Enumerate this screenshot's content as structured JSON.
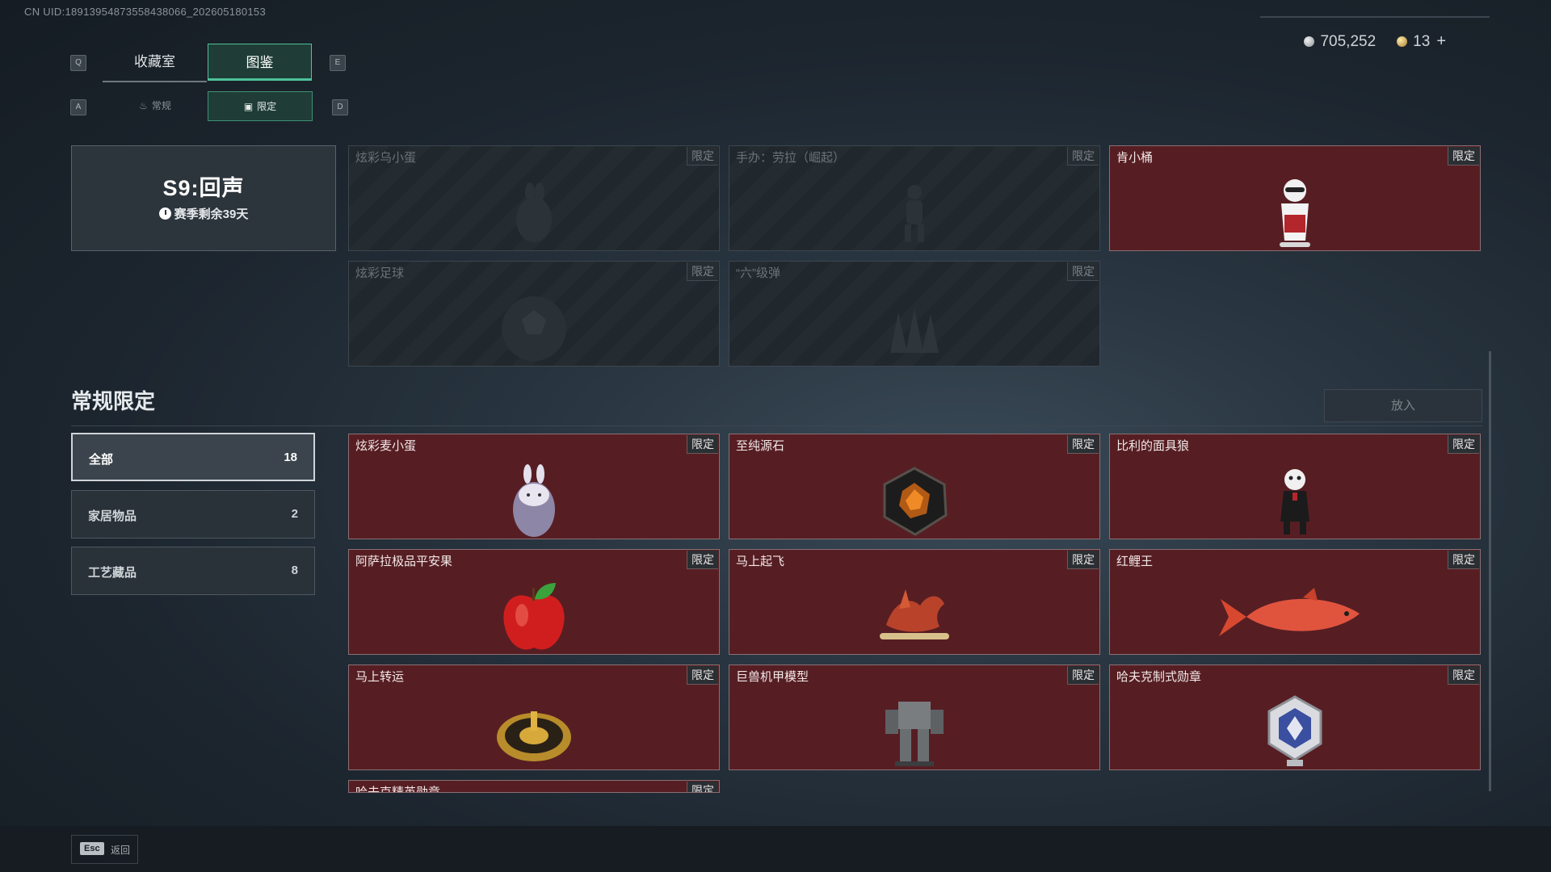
{
  "uid": "CN UID:18913954873558438066_202605180153",
  "keys": {
    "q": "Q",
    "e": "E",
    "a": "A",
    "d": "D",
    "esc": "Esc"
  },
  "tabs_primary": [
    {
      "label": "收藏室"
    },
    {
      "label": "图鉴"
    }
  ],
  "tabs_secondary": [
    {
      "label": "常规"
    },
    {
      "label": "限定"
    }
  ],
  "currency": {
    "silver": "705,252",
    "gold": "13",
    "plus": "+"
  },
  "season": {
    "title": "S9:回声",
    "remaining": "赛季剩余39天"
  },
  "limited_tag": "限定",
  "season_items": [
    {
      "name": "炫彩乌小蛋"
    },
    {
      "name": "手办：劳拉（崛起）"
    },
    {
      "name": "肯小桶"
    },
    {
      "name": "炫彩足球"
    },
    {
      "name": "“六”级弹"
    }
  ],
  "section": {
    "title": "常规限定",
    "put_in": "放入"
  },
  "categories": [
    {
      "label": "全部",
      "count": "18"
    },
    {
      "label": "家居物品",
      "count": "2"
    },
    {
      "label": "工艺藏品",
      "count": "8"
    }
  ],
  "items": [
    {
      "name": "炫彩麦小蛋"
    },
    {
      "name": "至纯源石"
    },
    {
      "name": "比利的面具狼"
    },
    {
      "name": "阿萨拉极品平安果"
    },
    {
      "name": "马上起飞"
    },
    {
      "name": "红鲤王"
    },
    {
      "name": "马上转运"
    },
    {
      "name": "巨兽机甲模型"
    },
    {
      "name": "哈夫克制式勋章"
    },
    {
      "name": "哈夫克精英勋章"
    }
  ],
  "footer": {
    "back": "返回"
  },
  "colors": {
    "accent": "#4ec29a",
    "card_bg": "#561e23",
    "tag_bg": "#2a2f33"
  }
}
